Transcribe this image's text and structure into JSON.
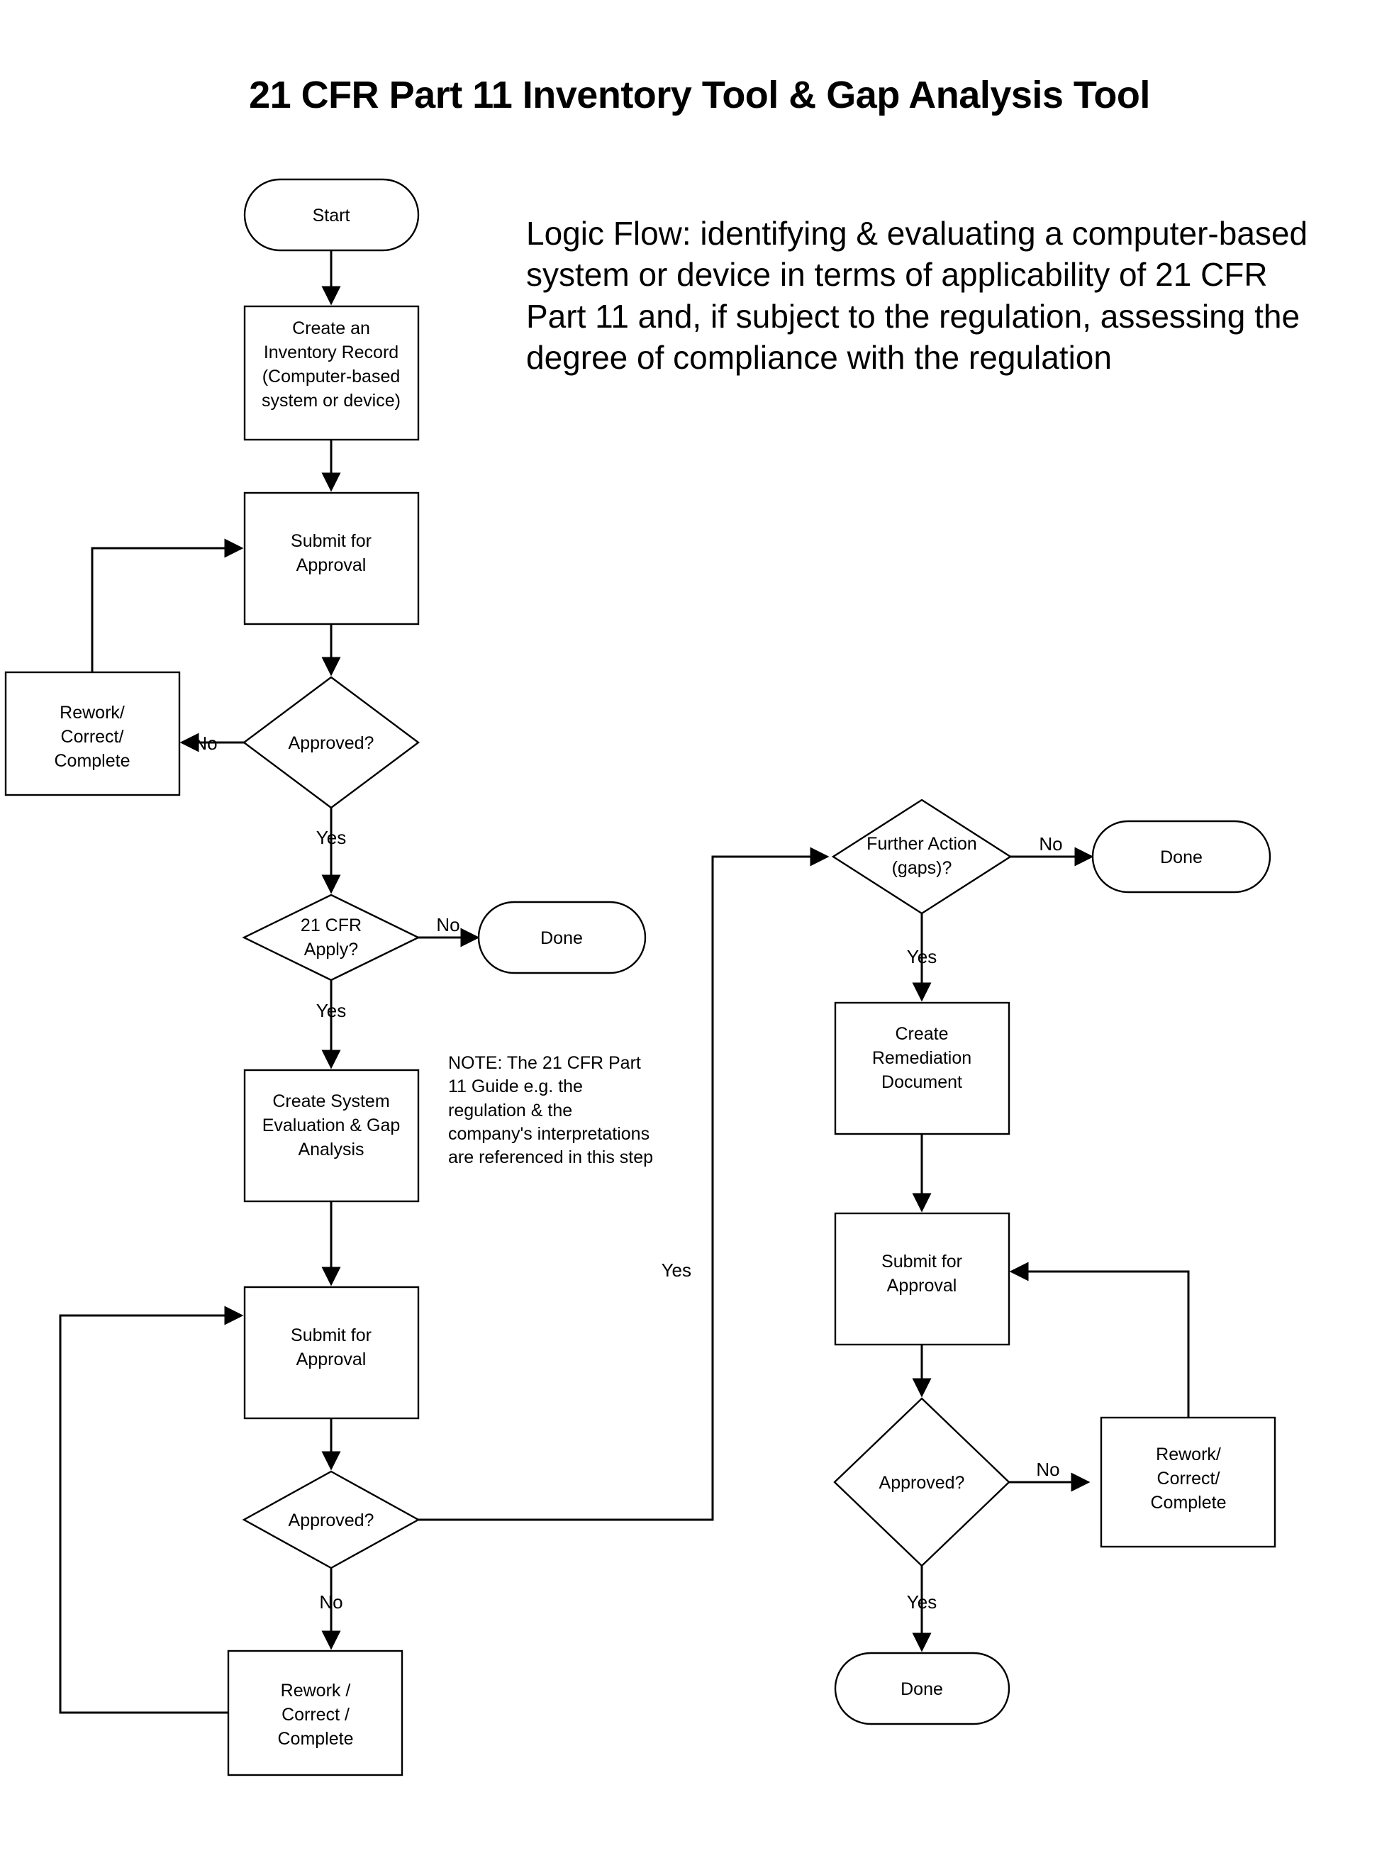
{
  "document": {
    "title": "21 CFR Part 11 Inventory Tool & Gap Analysis Tool",
    "intro_paragraph": "Logic Flow: identifying & evaluating a computer-based system or device in terms of applicability of 21 CFR Part 11 and, if subject to the regulation, assessing the degree of compliance with the regulation",
    "note": "NOTE: The 21 CFR Part 11 Guide e.g. the regulation & the company's interpretations are referenced in this step"
  },
  "colors": {
    "ink": "#000000",
    "paper": "#ffffff"
  },
  "flowchart": {
    "type": "flowchart",
    "nodes": [
      {
        "id": "start",
        "shape": "terminator",
        "lines": [
          "Start"
        ]
      },
      {
        "id": "create-inventory",
        "shape": "process",
        "lines": [
          "Create an",
          "Inventory Record",
          "(Computer-based",
          "system or device)"
        ]
      },
      {
        "id": "submit-1",
        "shape": "process",
        "lines": [
          "Submit for",
          "Approval"
        ]
      },
      {
        "id": "approved-1",
        "shape": "decision",
        "lines": [
          "Approved?"
        ]
      },
      {
        "id": "rework-1",
        "shape": "process",
        "lines": [
          "Rework/",
          "Correct/",
          "Complete"
        ]
      },
      {
        "id": "cfr-apply",
        "shape": "decision",
        "lines": [
          "21 CFR",
          "Apply?"
        ]
      },
      {
        "id": "done-1",
        "shape": "terminator",
        "lines": [
          "Done"
        ]
      },
      {
        "id": "create-eval",
        "shape": "process",
        "lines": [
          "Create System",
          "Evaluation & Gap",
          "Analysis"
        ]
      },
      {
        "id": "submit-2",
        "shape": "process",
        "lines": [
          "Submit for",
          "Approval"
        ]
      },
      {
        "id": "approved-2",
        "shape": "decision",
        "lines": [
          "Approved?"
        ]
      },
      {
        "id": "rework-2",
        "shape": "process",
        "lines": [
          "Rework /",
          "Correct /",
          "Complete"
        ]
      },
      {
        "id": "further-action",
        "shape": "decision",
        "lines": [
          "Further Action",
          "(gaps)?"
        ]
      },
      {
        "id": "done-2",
        "shape": "terminator",
        "lines": [
          "Done"
        ]
      },
      {
        "id": "create-remed",
        "shape": "process",
        "lines": [
          "Create",
          "Remediation",
          "Document"
        ]
      },
      {
        "id": "submit-3",
        "shape": "process",
        "lines": [
          "Submit for",
          "Approval"
        ]
      },
      {
        "id": "approved-3",
        "shape": "decision",
        "lines": [
          "Approved?"
        ]
      },
      {
        "id": "rework-3",
        "shape": "process",
        "lines": [
          "Rework/",
          "Correct/",
          "Complete"
        ]
      },
      {
        "id": "done-3",
        "shape": "terminator",
        "lines": [
          "Done"
        ]
      }
    ],
    "edges": [
      {
        "from": "start",
        "to": "create-inventory",
        "label": ""
      },
      {
        "from": "create-inventory",
        "to": "submit-1",
        "label": ""
      },
      {
        "from": "submit-1",
        "to": "approved-1",
        "label": ""
      },
      {
        "from": "approved-1",
        "to": "rework-1",
        "label": "No"
      },
      {
        "from": "rework-1",
        "to": "submit-1",
        "label": ""
      },
      {
        "from": "approved-1",
        "to": "cfr-apply",
        "label": "Yes"
      },
      {
        "from": "cfr-apply",
        "to": "done-1",
        "label": "No"
      },
      {
        "from": "cfr-apply",
        "to": "create-eval",
        "label": "Yes"
      },
      {
        "from": "create-eval",
        "to": "submit-2",
        "label": ""
      },
      {
        "from": "submit-2",
        "to": "approved-2",
        "label": ""
      },
      {
        "from": "approved-2",
        "to": "rework-2",
        "label": "No"
      },
      {
        "from": "rework-2",
        "to": "submit-2",
        "label": ""
      },
      {
        "from": "approved-2",
        "to": "further-action",
        "label": "Yes"
      },
      {
        "from": "further-action",
        "to": "done-2",
        "label": "No"
      },
      {
        "from": "further-action",
        "to": "create-remed",
        "label": "Yes"
      },
      {
        "from": "create-remed",
        "to": "submit-3",
        "label": ""
      },
      {
        "from": "submit-3",
        "to": "approved-3",
        "label": ""
      },
      {
        "from": "approved-3",
        "to": "rework-3",
        "label": "No"
      },
      {
        "from": "rework-3",
        "to": "submit-3",
        "label": ""
      },
      {
        "from": "approved-3",
        "to": "done-3",
        "label": "Yes"
      }
    ],
    "edge_labels": {
      "approved1_no": "No",
      "approved1_yes": "Yes",
      "cfr_no": "No",
      "cfr_yes": "Yes",
      "approved2_no": "No",
      "approved2_yes": "Yes",
      "further_no": "No",
      "further_yes": "Yes",
      "approved3_no": "No",
      "approved3_yes": "Yes"
    },
    "node_text": {
      "start": "Start",
      "create_inventory_l1": "Create an",
      "create_inventory_l2": "Inventory Record",
      "create_inventory_l3": "(Computer-based",
      "create_inventory_l4": "system or device)",
      "submit1_l1": "Submit for",
      "submit1_l2": "Approval",
      "approved1": "Approved?",
      "rework1_l1": "Rework/",
      "rework1_l2": "Correct/",
      "rework1_l3": "Complete",
      "cfr_l1": "21 CFR",
      "cfr_l2": "Apply?",
      "done1": "Done",
      "eval_l1": "Create System",
      "eval_l2": "Evaluation & Gap",
      "eval_l3": "Analysis",
      "submit2_l1": "Submit for",
      "submit2_l2": "Approval",
      "approved2": "Approved?",
      "rework2_l1": "Rework /",
      "rework2_l2": "Correct /",
      "rework2_l3": "Complete",
      "further_l1": "Further Action",
      "further_l2": "(gaps)?",
      "done2": "Done",
      "remed_l1": "Create",
      "remed_l2": "Remediation",
      "remed_l3": "Document",
      "submit3_l1": "Submit for",
      "submit3_l2": "Approval",
      "approved3": "Approved?",
      "rework3_l1": "Rework/",
      "rework3_l2": "Correct/",
      "rework3_l3": "Complete",
      "done3": "Done"
    }
  }
}
